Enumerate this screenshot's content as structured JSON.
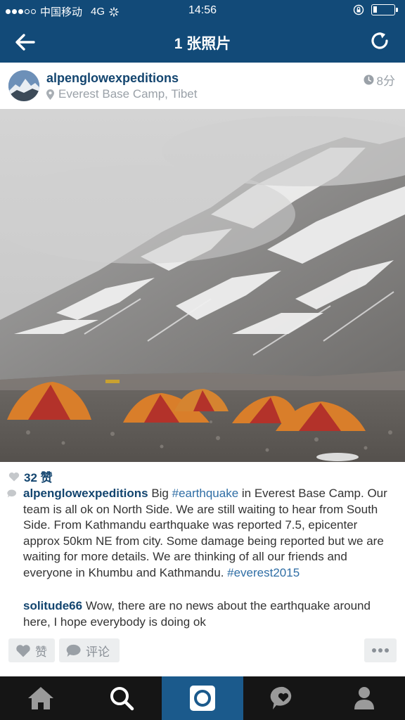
{
  "status_bar": {
    "carrier": "中国移动",
    "network": "4G",
    "time": "14:56"
  },
  "nav": {
    "title": "1 张照片"
  },
  "post": {
    "username": "alpenglowexpeditions",
    "location": "Everest Base Camp, Tibet",
    "time_ago": "8分",
    "likes": "32 赞",
    "caption": {
      "username": "alpenglowexpeditions",
      "text_before": " Big ",
      "hashtag1": "#earthquake",
      "text_middle": " in Everest Base Camp. Our team is all ok on North Side. We are still waiting to hear from South Side. From Kathmandu earthquake was reported 7.5, epicenter approx 50km NE from city. Some damage being reported but we are waiting for more details. We are thinking of all our friends and everyone in Khumbu and Kathmandu. ",
      "hashtag2": "#everest2015"
    },
    "comments": [
      {
        "username": "solitude66",
        "text": " Wow, there are no news about the earthquake around here, I hope everybody is doing ok"
      }
    ]
  },
  "actions": {
    "like_label": "赞",
    "comment_label": "评论"
  },
  "tabs": [
    {
      "icon": "home-icon"
    },
    {
      "icon": "search-icon"
    },
    {
      "icon": "camera-icon"
    },
    {
      "icon": "activity-icon"
    },
    {
      "icon": "profile-icon"
    }
  ],
  "colors": {
    "nav_blue": "#124A78",
    "username_blue": "#13456f",
    "hashtag_blue": "#2f6ea5",
    "active_tab": "#1b5a8c"
  }
}
